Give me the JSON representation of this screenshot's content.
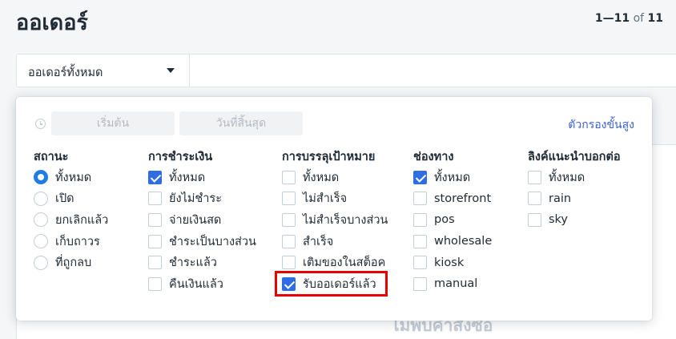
{
  "page": {
    "title": "ออเดอร์"
  },
  "pager": {
    "range": "1—11",
    "of": "of",
    "total": "11"
  },
  "filterbar": {
    "selected": "ออเดอร์ทั้งหมด"
  },
  "background": {
    "empty_text": "ไม่พบคำสั่งซื้อ"
  },
  "popover": {
    "start_placeholder": "เริ่มต้น",
    "end_placeholder": "วันที่สิ้นสุด",
    "advanced_link": "ตัวกรองขั้นสูง",
    "status": {
      "heading": "สถานะ",
      "options": [
        {
          "label": "ทั้งหมด",
          "checked": true
        },
        {
          "label": "เปิด",
          "checked": false
        },
        {
          "label": "ยกเลิกแล้ว",
          "checked": false
        },
        {
          "label": "เก็บถาวร",
          "checked": false
        },
        {
          "label": "ที่ถูกลบ",
          "checked": false
        }
      ]
    },
    "payment": {
      "heading": "การชำระเงิน",
      "options": [
        {
          "label": "ทั้งหมด",
          "checked": true
        },
        {
          "label": "ยังไม่ชำระ",
          "checked": false
        },
        {
          "label": "จ่ายเงินสด",
          "checked": false
        },
        {
          "label": "ชำระเป็นบางส่วน",
          "checked": false
        },
        {
          "label": "ชำระแล้ว",
          "checked": false
        },
        {
          "label": "คืนเงินแล้ว",
          "checked": false
        }
      ]
    },
    "fulfillment": {
      "heading": "การบรรลุเป้าหมาย",
      "options": [
        {
          "label": "ทั้งหมด",
          "checked": false
        },
        {
          "label": "ไม่สำเร็จ",
          "checked": false
        },
        {
          "label": "ไม่สำเร็จบางส่วน",
          "checked": false
        },
        {
          "label": "สำเร็จ",
          "checked": false
        },
        {
          "label": "เติมของในสต็อค",
          "checked": false
        },
        {
          "label": "รับออเดอร์แล้ว",
          "checked": true
        }
      ]
    },
    "channel": {
      "heading": "ช่องทาง",
      "options": [
        {
          "label": "ทั้งหมด",
          "checked": true
        },
        {
          "label": "storefront",
          "checked": false
        },
        {
          "label": "pos",
          "checked": false
        },
        {
          "label": "wholesale",
          "checked": false
        },
        {
          "label": "kiosk",
          "checked": false
        },
        {
          "label": "manual",
          "checked": false
        }
      ]
    },
    "referrer": {
      "heading": "ลิงค์แนะนำบอกต่อ",
      "options": [
        {
          "label": "ทั้งหมด",
          "checked": false
        },
        {
          "label": "rain",
          "checked": false
        },
        {
          "label": "sky",
          "checked": false
        }
      ]
    }
  },
  "colors": {
    "accent": "#2f6ee2",
    "highlight": "#e60000",
    "link": "#3f63c6"
  }
}
